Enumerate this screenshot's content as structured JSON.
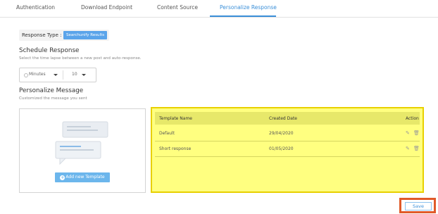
{
  "tabs": [
    {
      "label": "Authentication"
    },
    {
      "label": "Download Endpoint"
    },
    {
      "label": "Content Source"
    },
    {
      "label": "Personalize Response"
    }
  ],
  "active_tab": "Personalize Response",
  "response_type": {
    "label": "Response Type :",
    "value": "Searchunify Results"
  },
  "schedule": {
    "title": "Schedule Response",
    "description": "Select the time lapse between a new post and auto-response.",
    "unit": "Minutes",
    "value": "10"
  },
  "personalize": {
    "title": "Personalize Message",
    "description": "Customized the message you sent",
    "add_template_label": "Add new Template"
  },
  "table": {
    "columns": [
      "Template Name",
      "Created Date",
      "Action"
    ],
    "rows": [
      {
        "name": "Default",
        "date": "29/04/2020"
      },
      {
        "name": "Short response",
        "date": "01/05/2020"
      }
    ]
  },
  "footer": {
    "save_label": "Save"
  },
  "colors": {
    "accent": "#3a8fd8",
    "highlight": "#ffff80",
    "save_outline": "#e05a2a"
  }
}
